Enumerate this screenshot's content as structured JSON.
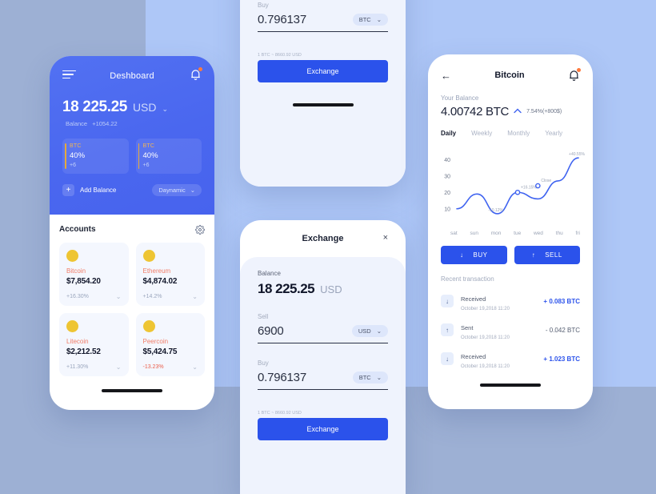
{
  "theme": {
    "accent": "#2b52eb",
    "header_blue": "#4a67ef",
    "coin_gold": "#eec533",
    "coin_name": "#f07d68",
    "negative": "#ea5f4b",
    "bg_left": "#9db0d4",
    "bg_right": "#aec7f7"
  },
  "dashboard": {
    "title": "Deshboard",
    "menu_icon": "hamburger-icon",
    "bell_icon": "bell-icon",
    "amount": "18 225.25",
    "currency": "USD",
    "currency_caret": "⌄",
    "balance_label": "Balance",
    "balance_change": "+1054.22",
    "stats": [
      {
        "coin": "BTC",
        "percent": "40%",
        "sub": "+6"
      },
      {
        "coin": "BTC",
        "percent": "40%",
        "sub": "+6"
      }
    ],
    "add_balance_label": "Add Balance",
    "plus_icon": "+",
    "dropdown_label": "Daynamic",
    "dropdown_caret": "⌄",
    "accounts_title": "Accounts",
    "gear_icon": "gear-icon",
    "accounts": [
      {
        "name": "Bitcoin",
        "value": "$7,854.20",
        "percent": "+16.30%",
        "negative": false
      },
      {
        "name": "Ethereum",
        "value": "$4,874.02",
        "percent": "+14.2%",
        "negative": false
      },
      {
        "name": "Litecoin",
        "value": "$2,212.52",
        "percent": "+11.30%",
        "negative": false
      },
      {
        "name": "Peercoin",
        "value": "$5,424.75",
        "percent": "-13.23%",
        "negative": true
      }
    ]
  },
  "exchange": {
    "title": "Exchange",
    "close_icon": "×",
    "balance_label": "Balance",
    "balance_amount": "18 225.25",
    "balance_currency": "USD",
    "sell_label": "Sell",
    "sell_value": "6900",
    "sell_currency": "USD",
    "buy_label": "Buy",
    "buy_value": "0.796137",
    "buy_currency": "BTC",
    "caret": "⌄",
    "rate_note": "1 BTC ~ 8660.92 USD",
    "button_label": "Exchange"
  },
  "bitcoin": {
    "back_icon": "←",
    "title": "Bitcoin",
    "bell_icon": "bell-icon",
    "balance_label": "Your Balance",
    "balance_amount": "4.00742 BTC",
    "trend_icon": "▲",
    "change": "7.54%(+800$)",
    "tabs": [
      {
        "label": "Daily",
        "active": true
      },
      {
        "label": "Weekly",
        "active": false
      },
      {
        "label": "Monthly",
        "active": false
      },
      {
        "label": "Yearly",
        "active": false
      }
    ],
    "buy_label": "BUY",
    "buy_icon": "↓",
    "sell_label": "SELL",
    "sell_icon": "↑",
    "recent_title": "Recent transaction",
    "transactions": [
      {
        "type": "Received",
        "date": "October 19,2018 11:20",
        "amount": "+ 0.083 BTC",
        "icon": "↓",
        "incoming": true
      },
      {
        "type": "Sent",
        "date": "October 19,2018 11:20",
        "amount": "- 0.042 BTC",
        "icon": "↑",
        "incoming": false
      },
      {
        "type": "Received",
        "date": "October 19,2018 11:20",
        "amount": "+ 1.023 BTC",
        "icon": "↓",
        "incoming": true
      }
    ]
  },
  "chart_data": {
    "type": "line",
    "title": "",
    "xlabel": "",
    "ylabel": "",
    "categories": [
      "sat",
      "sun",
      "mon",
      "tue",
      "wed",
      "thu",
      "fri"
    ],
    "values": [
      10,
      19,
      7,
      20,
      16,
      27,
      41
    ],
    "ylim": [
      5,
      45
    ],
    "yticks": [
      10,
      20,
      30,
      40
    ],
    "grid": false,
    "legend": "none",
    "line_color": "#3f63f0",
    "annotations": [
      {
        "x": "mon",
        "value": 7,
        "label": "-10.12%"
      },
      {
        "x": "tue",
        "value": 20,
        "label": "+16.15%",
        "marker": true
      },
      {
        "x": "wed",
        "value": 24,
        "label": "Close",
        "marker": true
      },
      {
        "x": "fri",
        "value": 41,
        "label": "+40.55%"
      }
    ]
  }
}
